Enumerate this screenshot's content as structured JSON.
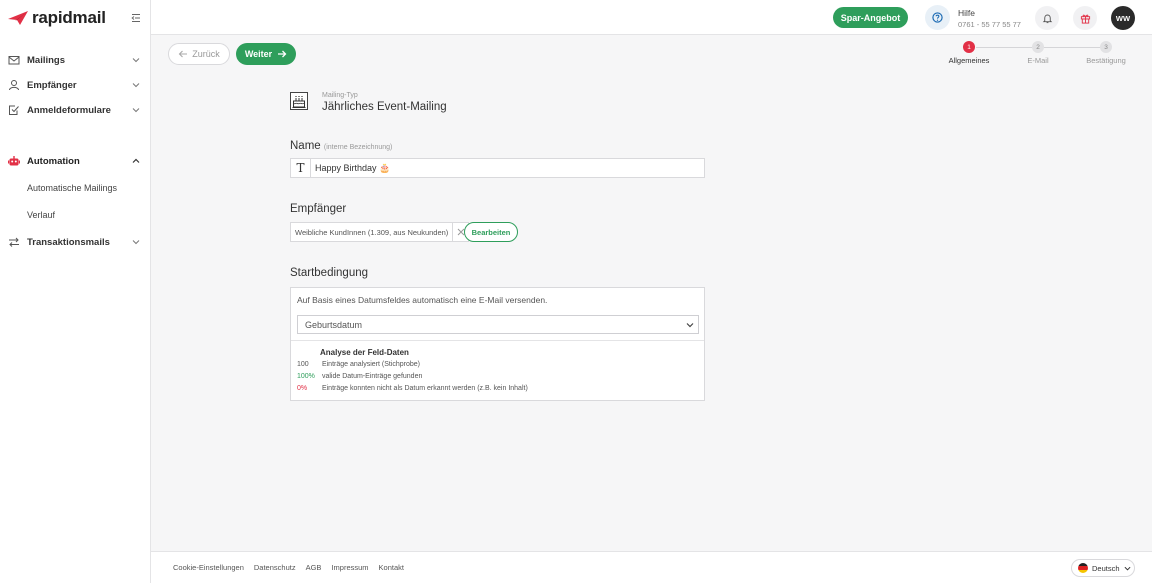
{
  "app": {
    "brand": "rapidmail"
  },
  "sidebar": {
    "items": [
      {
        "label": "Mailings",
        "icon": "mail-icon"
      },
      {
        "label": "Empfänger",
        "icon": "user-icon"
      },
      {
        "label": "Anmeldeformulare",
        "icon": "form-check-icon"
      },
      {
        "label": "Automation",
        "icon": "robot-icon",
        "expanded": true
      },
      {
        "label": "Transaktionsmails",
        "icon": "transfer-arrows-icon"
      }
    ],
    "sub_items": [
      "Automatische Mailings",
      "Verlauf"
    ]
  },
  "topbar": {
    "offer_label": "Spar-Angebot",
    "help_title": "Hilfe",
    "help_phone": "0761 - 55 77 55 77",
    "avatar_initials": "WW"
  },
  "actions": {
    "back_label": "Zurück",
    "next_label": "Weiter"
  },
  "stepper": {
    "steps": [
      {
        "number": "1",
        "label": "Allgemeines",
        "active": true
      },
      {
        "number": "2",
        "label": "E-Mail",
        "active": false
      },
      {
        "number": "3",
        "label": "Bestätigung",
        "active": false
      }
    ]
  },
  "mailing_type": {
    "caption": "Mailing-Typ",
    "title": "Jährliches Event-Mailing"
  },
  "name_section": {
    "title": "Name",
    "hint": "(interne Bezeichnung)",
    "value": "Happy Birthday 🎂",
    "prefix_icon": "text-T-icon"
  },
  "recipients_section": {
    "title": "Empfänger",
    "tag_label": "Weibliche KundInnen (1.309, aus Neukunden)",
    "edit_label": "Bearbeiten"
  },
  "start_section": {
    "title": "Startbedingung",
    "description": "Auf Basis eines Datumsfeldes automatisch eine E-Mail versenden.",
    "selected_field": "Geburtsdatum",
    "analysis_title": "Analyse der Feld-Daten",
    "rows": [
      {
        "value": "100",
        "text": "Einträge analysiert (Stichprobe)",
        "color": "#555555"
      },
      {
        "value": "100%",
        "text": "valide Datum-Einträge gefunden",
        "color": "#2e9e5b"
      },
      {
        "value": "0%",
        "text": "Einträge konnten nicht als Datum erkannt werden (z.B. kein Inhalt)",
        "color": "#e23046"
      }
    ]
  },
  "footer": {
    "links": [
      "Cookie-Einstellungen",
      "Datenschutz",
      "AGB",
      "Impressum",
      "Kontakt"
    ],
    "language": "Deutsch"
  },
  "colors": {
    "brand_red": "#e23046",
    "accent_green": "#2e9e5b"
  }
}
